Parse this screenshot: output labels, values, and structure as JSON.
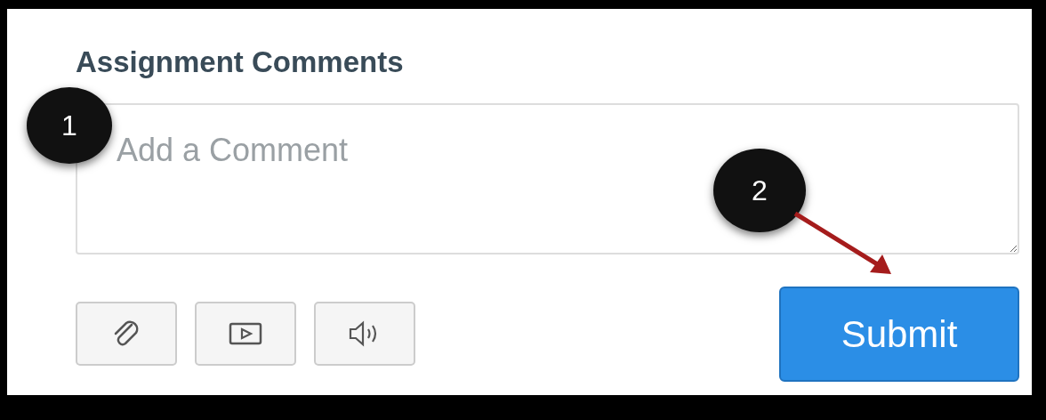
{
  "heading": "Assignment Comments",
  "comment_field": {
    "placeholder": "Add a Comment"
  },
  "tools": [
    {
      "kind": "attach"
    },
    {
      "kind": "media"
    },
    {
      "kind": "audio"
    }
  ],
  "submit": {
    "label": "Submit"
  },
  "callouts": [
    "1",
    "2"
  ]
}
